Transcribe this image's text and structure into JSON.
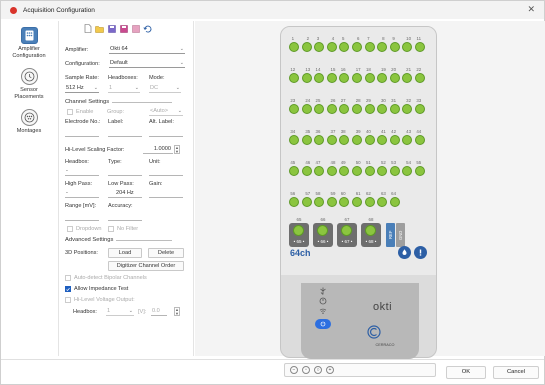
{
  "window": {
    "title": "Acquisition Configuration"
  },
  "nav": [
    {
      "label": "Amplifier Configuration",
      "icon": "amplifier-icon"
    },
    {
      "label": "Sensor Placements",
      "icon": "clock-sensor-icon"
    },
    {
      "label": "Montages",
      "icon": "montage-icon"
    }
  ],
  "toolbar": [
    "new-file-icon",
    "open-folder-icon",
    "save-icon",
    "save-as-icon",
    "export-icon",
    "undo-icon"
  ],
  "config": {
    "amplifier_label": "Amplifier:",
    "amplifier_value": "Okti 64",
    "configuration_label": "Configuration:",
    "configuration_value": "Default",
    "sample_rate_label": "Sample Rate:",
    "sample_rate_value": "512 Hz",
    "headboxes_label": "Headboxes:",
    "headboxes_value": "1",
    "mode_label": "Mode:",
    "mode_value": "DC"
  },
  "channel_settings": {
    "header": "Channel Settings",
    "enable_label": "Enable",
    "group_label": "Group:",
    "group_value": "<Auto>",
    "electrode_label": "Electrode No.:",
    "label_label": "Label:",
    "alt_label": "Alt. Label:",
    "scaling_label": "Hi-Level Scaling Factor:",
    "scaling_value": "1.0000",
    "headbox_label": "Headbox:",
    "type_label": "Type:",
    "unit_label": "Unit:",
    "high_pass_label": "High Pass:",
    "low_pass_label": "Low Pass:",
    "gain_label": "Gain:",
    "high_pass_value": "-",
    "low_pass_value": "204 Hz",
    "gain_value": "",
    "range_label": "Range [mV]:",
    "accuracy_label": "Accuracy:",
    "range_value": "",
    "accuracy_value": "",
    "dropdown_label": "Dropdown",
    "no_filter_label": "No Filter"
  },
  "advanced": {
    "header": "Advanced Settings",
    "positions_label": "3D Positions:",
    "load_label": "Load",
    "delete_label": "Delete",
    "digitizer_label": "Digitizer Channel Order",
    "bipolar_label": "Auto-detect Bipolar Channels",
    "impedance_label": "Allow Impedance Test",
    "hilevel_label": "Hi-Level Voltage Output:",
    "headbox_label": "Headbox:",
    "headbox_value": "1",
    "v_label": "[V]:",
    "v_value": "0.0"
  },
  "amplifier": {
    "channels": 64,
    "channel_count_label": "64ch",
    "brand": "okti",
    "maker": "CERRACO",
    "ref_channels": [
      {
        "num": "65",
        "label": "• 65 •"
      },
      {
        "num": "66",
        "label": "• 66 •"
      },
      {
        "num": "67",
        "label": "• 67 •"
      },
      {
        "num": "68",
        "label": "• 68 •"
      }
    ],
    "ref_tab": "REF",
    "gnd_tab": "GND",
    "colors": {
      "channel": "#8bc53f",
      "tab_ref": "#4a7fb8",
      "tab_gnd": "#9e9e9e",
      "accent": "#2d5fa5"
    }
  },
  "zoom": [
    "zoom-out-icon",
    "zoom-fit-icon",
    "zoom-reset-icon",
    "zoom-in-icon"
  ],
  "footer": {
    "ok_label": "OK",
    "cancel_label": "Cancel"
  }
}
